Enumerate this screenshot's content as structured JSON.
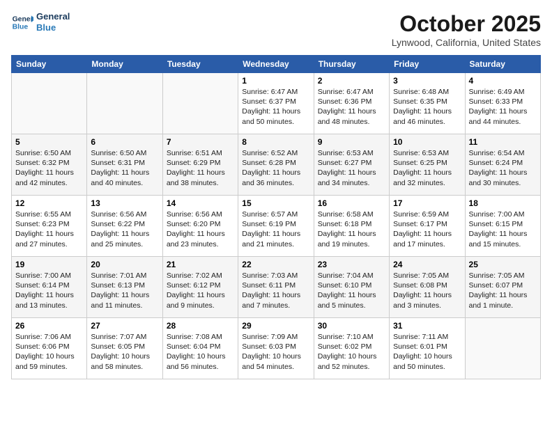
{
  "header": {
    "logo_line1": "General",
    "logo_line2": "Blue",
    "month": "October 2025",
    "location": "Lynwood, California, United States"
  },
  "days_of_week": [
    "Sunday",
    "Monday",
    "Tuesday",
    "Wednesday",
    "Thursday",
    "Friday",
    "Saturday"
  ],
  "weeks": [
    [
      {
        "day": "",
        "content": ""
      },
      {
        "day": "",
        "content": ""
      },
      {
        "day": "",
        "content": ""
      },
      {
        "day": "1",
        "content": "Sunrise: 6:47 AM\nSunset: 6:37 PM\nDaylight: 11 hours\nand 50 minutes."
      },
      {
        "day": "2",
        "content": "Sunrise: 6:47 AM\nSunset: 6:36 PM\nDaylight: 11 hours\nand 48 minutes."
      },
      {
        "day": "3",
        "content": "Sunrise: 6:48 AM\nSunset: 6:35 PM\nDaylight: 11 hours\nand 46 minutes."
      },
      {
        "day": "4",
        "content": "Sunrise: 6:49 AM\nSunset: 6:33 PM\nDaylight: 11 hours\nand 44 minutes."
      }
    ],
    [
      {
        "day": "5",
        "content": "Sunrise: 6:50 AM\nSunset: 6:32 PM\nDaylight: 11 hours\nand 42 minutes."
      },
      {
        "day": "6",
        "content": "Sunrise: 6:50 AM\nSunset: 6:31 PM\nDaylight: 11 hours\nand 40 minutes."
      },
      {
        "day": "7",
        "content": "Sunrise: 6:51 AM\nSunset: 6:29 PM\nDaylight: 11 hours\nand 38 minutes."
      },
      {
        "day": "8",
        "content": "Sunrise: 6:52 AM\nSunset: 6:28 PM\nDaylight: 11 hours\nand 36 minutes."
      },
      {
        "day": "9",
        "content": "Sunrise: 6:53 AM\nSunset: 6:27 PM\nDaylight: 11 hours\nand 34 minutes."
      },
      {
        "day": "10",
        "content": "Sunrise: 6:53 AM\nSunset: 6:25 PM\nDaylight: 11 hours\nand 32 minutes."
      },
      {
        "day": "11",
        "content": "Sunrise: 6:54 AM\nSunset: 6:24 PM\nDaylight: 11 hours\nand 30 minutes."
      }
    ],
    [
      {
        "day": "12",
        "content": "Sunrise: 6:55 AM\nSunset: 6:23 PM\nDaylight: 11 hours\nand 27 minutes."
      },
      {
        "day": "13",
        "content": "Sunrise: 6:56 AM\nSunset: 6:22 PM\nDaylight: 11 hours\nand 25 minutes."
      },
      {
        "day": "14",
        "content": "Sunrise: 6:56 AM\nSunset: 6:20 PM\nDaylight: 11 hours\nand 23 minutes."
      },
      {
        "day": "15",
        "content": "Sunrise: 6:57 AM\nSunset: 6:19 PM\nDaylight: 11 hours\nand 21 minutes."
      },
      {
        "day": "16",
        "content": "Sunrise: 6:58 AM\nSunset: 6:18 PM\nDaylight: 11 hours\nand 19 minutes."
      },
      {
        "day": "17",
        "content": "Sunrise: 6:59 AM\nSunset: 6:17 PM\nDaylight: 11 hours\nand 17 minutes."
      },
      {
        "day": "18",
        "content": "Sunrise: 7:00 AM\nSunset: 6:15 PM\nDaylight: 11 hours\nand 15 minutes."
      }
    ],
    [
      {
        "day": "19",
        "content": "Sunrise: 7:00 AM\nSunset: 6:14 PM\nDaylight: 11 hours\nand 13 minutes."
      },
      {
        "day": "20",
        "content": "Sunrise: 7:01 AM\nSunset: 6:13 PM\nDaylight: 11 hours\nand 11 minutes."
      },
      {
        "day": "21",
        "content": "Sunrise: 7:02 AM\nSunset: 6:12 PM\nDaylight: 11 hours\nand 9 minutes."
      },
      {
        "day": "22",
        "content": "Sunrise: 7:03 AM\nSunset: 6:11 PM\nDaylight: 11 hours\nand 7 minutes."
      },
      {
        "day": "23",
        "content": "Sunrise: 7:04 AM\nSunset: 6:10 PM\nDaylight: 11 hours\nand 5 minutes."
      },
      {
        "day": "24",
        "content": "Sunrise: 7:05 AM\nSunset: 6:08 PM\nDaylight: 11 hours\nand 3 minutes."
      },
      {
        "day": "25",
        "content": "Sunrise: 7:05 AM\nSunset: 6:07 PM\nDaylight: 11 hours\nand 1 minute."
      }
    ],
    [
      {
        "day": "26",
        "content": "Sunrise: 7:06 AM\nSunset: 6:06 PM\nDaylight: 10 hours\nand 59 minutes."
      },
      {
        "day": "27",
        "content": "Sunrise: 7:07 AM\nSunset: 6:05 PM\nDaylight: 10 hours\nand 58 minutes."
      },
      {
        "day": "28",
        "content": "Sunrise: 7:08 AM\nSunset: 6:04 PM\nDaylight: 10 hours\nand 56 minutes."
      },
      {
        "day": "29",
        "content": "Sunrise: 7:09 AM\nSunset: 6:03 PM\nDaylight: 10 hours\nand 54 minutes."
      },
      {
        "day": "30",
        "content": "Sunrise: 7:10 AM\nSunset: 6:02 PM\nDaylight: 10 hours\nand 52 minutes."
      },
      {
        "day": "31",
        "content": "Sunrise: 7:11 AM\nSunset: 6:01 PM\nDaylight: 10 hours\nand 50 minutes."
      },
      {
        "day": "",
        "content": ""
      }
    ]
  ]
}
